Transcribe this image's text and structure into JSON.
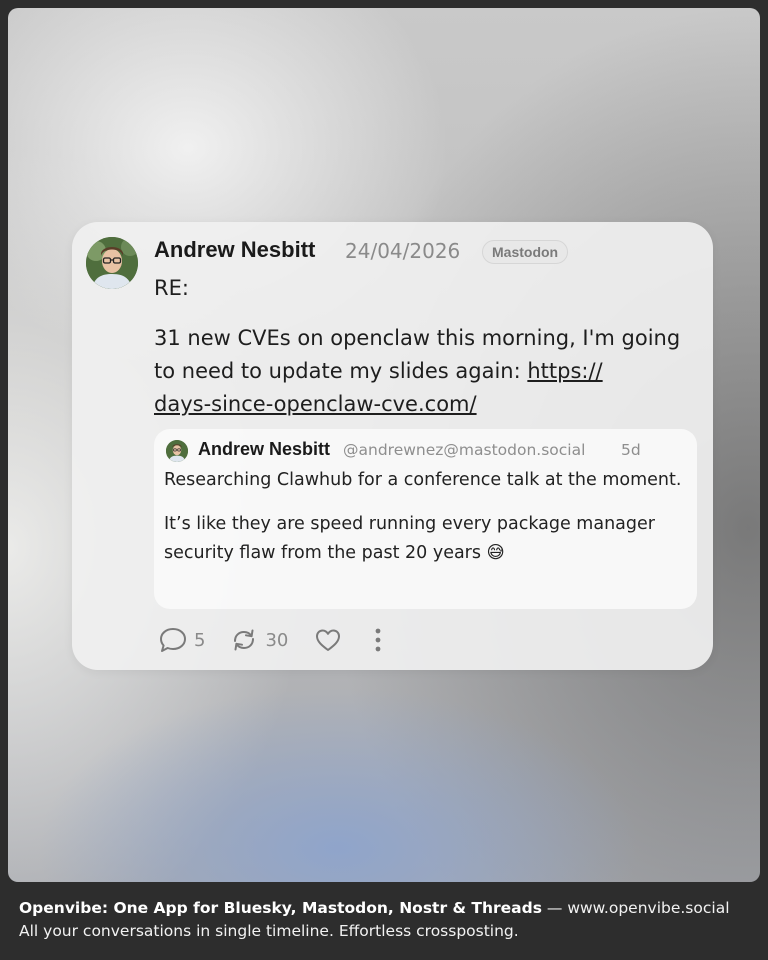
{
  "post": {
    "author": "Andrew Nesbitt",
    "date": "24/04/2026",
    "network_badge": "Mastodon",
    "text_line1": "RE:",
    "text_line2": "31 new CVEs on openclaw this morning, I'm going to need to update my slides again:",
    "link": "https://days-since-openclaw-cve.com/",
    "link_part1": "https://",
    "link_part2": "days-since-openclaw-cve.com/",
    "quoted": {
      "author": "Andrew Nesbitt",
      "handle": "@andrewnez@mastodon.social",
      "age": "5d",
      "paragraph1": "Researching Clawhub for a conference talk at the moment.",
      "paragraph2": "It’s like they are speed running every package manager security flaw from the past 20 years 😅"
    },
    "actions": {
      "replies_icon": "comment-icon",
      "replies": "5",
      "reposts_icon": "repost-icon",
      "reposts": "30",
      "like_icon": "heart-icon",
      "more_icon": "more-vertical-icon"
    }
  },
  "footer": {
    "headline": "Openvibe: One App for Bluesky, Mastodon, Nostr & Threads",
    "separator": " — ",
    "site": "www.openvibe.social",
    "tagline": "All your conversations in single timeline. Effortless crossposting."
  }
}
